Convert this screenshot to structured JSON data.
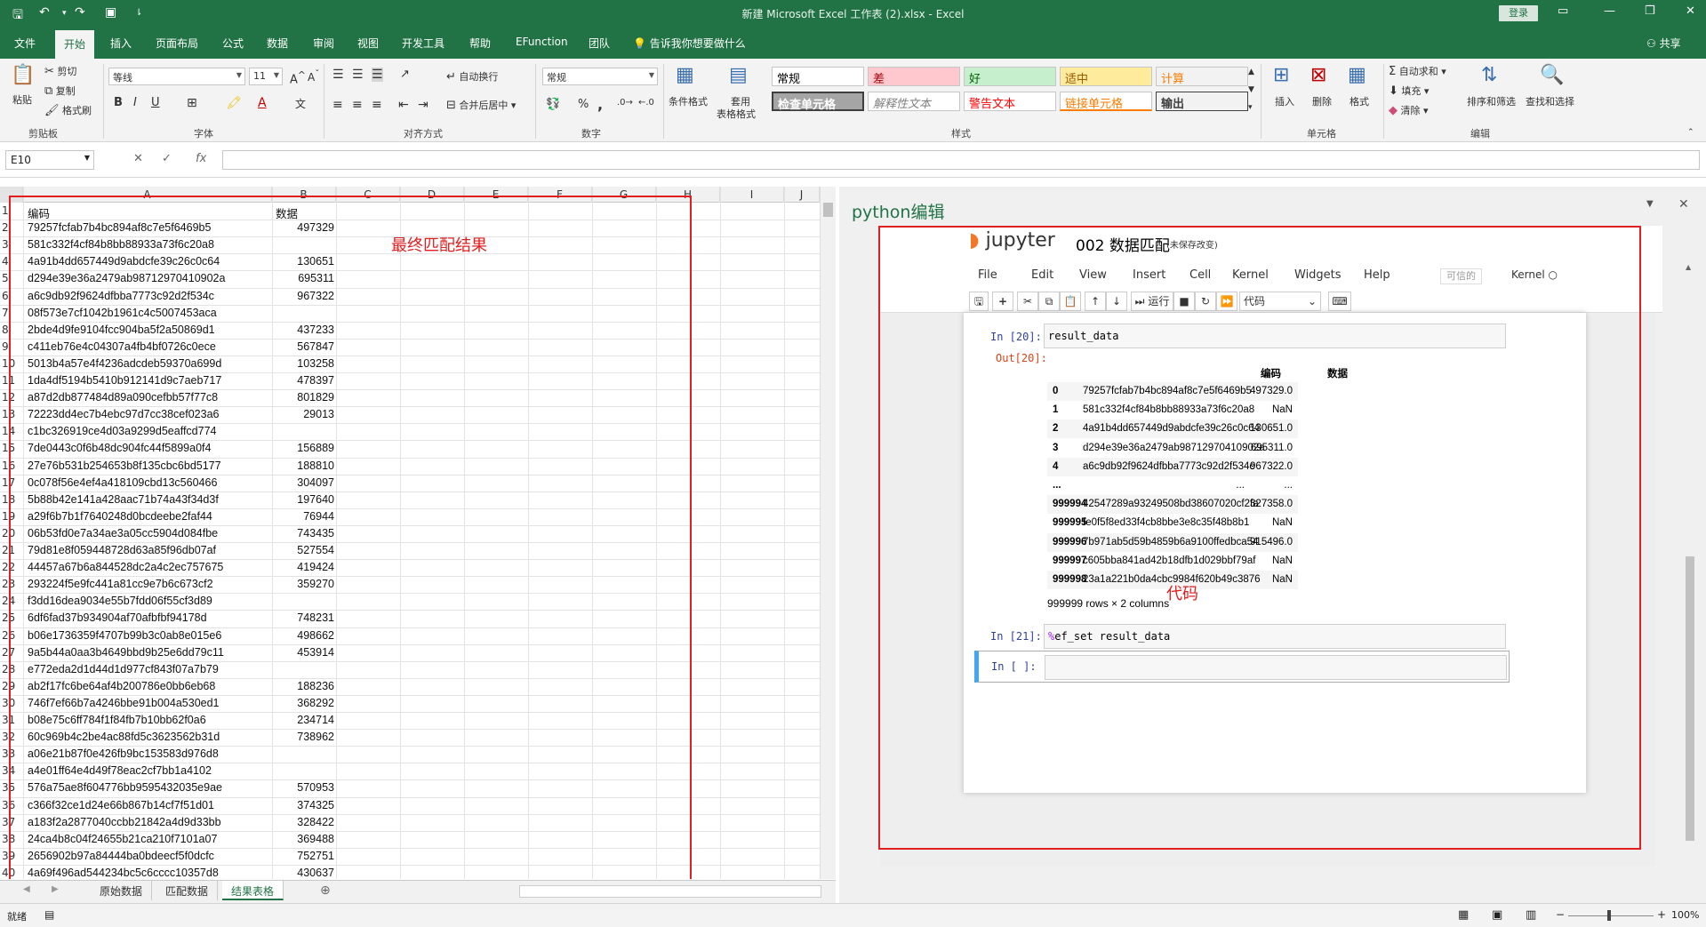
{
  "window": {
    "title": "新建 Microsoft Excel 工作表 (2).xlsx  -  Excel",
    "login": "登录"
  },
  "tabs": [
    "文件",
    "开始",
    "插入",
    "页面布局",
    "公式",
    "数据",
    "审阅",
    "视图",
    "开发工具",
    "帮助",
    "EFunction",
    "团队"
  ],
  "tellme": "告诉我你想要做什么",
  "share": "共享",
  "ribbon": {
    "clipboard": {
      "paste": "粘贴",
      "cut": "剪切",
      "copy": "复制",
      "format_painter": "格式刷",
      "label": "剪贴板"
    },
    "font": {
      "name": "等线",
      "size": "11",
      "label": "字体",
      "bold": "B",
      "italic": "I",
      "underline": "U"
    },
    "align": {
      "wrap": "自动换行",
      "merge": "合并后居中",
      "label": "对齐方式"
    },
    "number": {
      "format": "常规",
      "percent": "%",
      "comma": ",",
      "label": "数字"
    },
    "styles": {
      "conditional": "条件格式",
      "table_line1": "套用",
      "table_line2": "表格格式",
      "label": "样式",
      "cells": [
        {
          "text": "常规",
          "bg": "#ffffff",
          "fg": "#000000"
        },
        {
          "text": "差",
          "bg": "#ffc7ce",
          "fg": "#9c0006"
        },
        {
          "text": "好",
          "bg": "#c6efce",
          "fg": "#006100"
        },
        {
          "text": "适中",
          "bg": "#ffeb9c",
          "fg": "#9c5700"
        },
        {
          "text": "计算",
          "bg": "#f2f2f2",
          "fg": "#fa7d00"
        },
        {
          "text": "检查单元格",
          "bg": "#a5a5a5",
          "fg": "#ffffff"
        },
        {
          "text": "解释性文本",
          "bg": "#ffffff",
          "fg": "#7f7f7f"
        },
        {
          "text": "警告文本",
          "bg": "#ffffff",
          "fg": "#ff0000"
        },
        {
          "text": "链接单元格",
          "bg": "#ffffff",
          "fg": "#fa7d00"
        },
        {
          "text": "输出",
          "bg": "#f2f2f2",
          "fg": "#3f3f3f"
        }
      ]
    },
    "cells": {
      "insert": "插入",
      "delete": "删除",
      "format": "格式",
      "label": "单元格"
    },
    "editing": {
      "autosum": "自动求和",
      "fill": "填充",
      "clear": "清除",
      "sort": "排序和筛选",
      "find": "查找和选择",
      "label": "编辑"
    }
  },
  "formula_bar": {
    "name_box": "E10",
    "fx": "fx",
    "value": ""
  },
  "grid": {
    "columns": [
      "A",
      "B",
      "C",
      "D",
      "E",
      "F",
      "G",
      "H",
      "I",
      "J"
    ],
    "header_row": {
      "a": "编码",
      "b": "数据"
    },
    "rows": [
      {
        "n": "2",
        "a": "79257fcfab7b4bc894af8c7e5f6469b5",
        "b": "497329"
      },
      {
        "n": "3",
        "a": "581c332f4cf84b8bb88933a73f6c20a8",
        "b": ""
      },
      {
        "n": "4",
        "a": "4a91b4dd657449d9abdcfe39c26c0c64",
        "b": "130651"
      },
      {
        "n": "5",
        "a": "d294e39e36a2479ab98712970410902a",
        "b": "695311"
      },
      {
        "n": "6",
        "a": "a6c9db92f9624dfbba7773c92d2f534c",
        "b": "967322"
      },
      {
        "n": "7",
        "a": "08f573e7cf1042b1961c4c5007453aca",
        "b": ""
      },
      {
        "n": "8",
        "a": "2bde4d9fe9104fcc904ba5f2a50869d1",
        "b": "437233"
      },
      {
        "n": "9",
        "a": "c411eb76e4c04307a4fb4bf0726c0ece",
        "b": "567847"
      },
      {
        "n": "10",
        "a": "5013b4a57e4f4236adcdeb59370a699d",
        "b": "103258"
      },
      {
        "n": "11",
        "a": "1da4df5194b5410b912141d9c7aeb717",
        "b": "478397"
      },
      {
        "n": "12",
        "a": "a87d2db877484d89a090cefbb57f77c8",
        "b": "801829"
      },
      {
        "n": "13",
        "a": "72223dd4ec7b4ebc97d7cc38cef023a6",
        "b": "29013"
      },
      {
        "n": "14",
        "a": "c1bc326919ce4d03a9299d5eaffcd774",
        "b": ""
      },
      {
        "n": "15",
        "a": "7de0443c0f6b48dc904fc44f5899a0f4",
        "b": "156889"
      },
      {
        "n": "16",
        "a": "27e76b531b254653b8f135cbc6bd5177",
        "b": "188810"
      },
      {
        "n": "17",
        "a": "0c078f56e4ef4a418109cbd13c560466",
        "b": "304097"
      },
      {
        "n": "18",
        "a": "5b88b42e141a428aac71b74a43f34d3f",
        "b": "197640"
      },
      {
        "n": "19",
        "a": "a29f6b7b1f7640248d0bcdeebe2faf44",
        "b": "76944"
      },
      {
        "n": "20",
        "a": "06b53fd0e7a34ae3a05cc5904d084fbe",
        "b": "743435"
      },
      {
        "n": "21",
        "a": "79d81e8f059448728d63a85f96db07af",
        "b": "527554"
      },
      {
        "n": "22",
        "a": "44457a67b6a844528dc2a4c2ec757675",
        "b": "419424"
      },
      {
        "n": "23",
        "a": "293224f5e9fc441a81cc9e7b6c673cf2",
        "b": "359270"
      },
      {
        "n": "24",
        "a": "f3dd16dea9034e55b7fdd06f55cf3d89",
        "b": ""
      },
      {
        "n": "25",
        "a": "6df6fad37b934904af70afbfbf94178d",
        "b": "748231"
      },
      {
        "n": "26",
        "a": "b06e1736359f4707b99b3c0ab8e015e6",
        "b": "498662"
      },
      {
        "n": "27",
        "a": "9a5b44a0aa3b4649bbd9b25e6dd79c11",
        "b": "453914"
      },
      {
        "n": "28",
        "a": "e772eda2d1d44d1d977cf843f07a7b79",
        "b": ""
      },
      {
        "n": "29",
        "a": "ab2f17fc6be64af4b200786e0bb6eb68",
        "b": "188236"
      },
      {
        "n": "30",
        "a": "746f7ef66b7a4246bbe91b004a530ed1",
        "b": "368292"
      },
      {
        "n": "31",
        "a": "b08e75c6ff784f1f84fb7b10bb62f0a6",
        "b": "234714"
      },
      {
        "n": "32",
        "a": "60c969b4c2be4ac88fd5c3623562b31d",
        "b": "738962"
      },
      {
        "n": "33",
        "a": "a06e21b87f0e426fb9bc153583d976d8",
        "b": ""
      },
      {
        "n": "34",
        "a": "a4e01ff64e4d49f78eac2cf7bb1a4102",
        "b": ""
      },
      {
        "n": "35",
        "a": "576a75ae8f604776bb9595432035e9ae",
        "b": "570953"
      },
      {
        "n": "36",
        "a": "c366f32ce1d24e66b867b14cf7f51d01",
        "b": "374325"
      },
      {
        "n": "37",
        "a": "a183f2a2877040ccbb21842a4d9d33bb",
        "b": "328422"
      },
      {
        "n": "38",
        "a": "24ca4b8c04f24655b21ca210f7101a07",
        "b": "369488"
      },
      {
        "n": "39",
        "a": "2656902b97a84444ba0bdeecf5f0dcfc",
        "b": "752751"
      },
      {
        "n": "40",
        "a": "4a69f496ad544234bc5c6cccc10357d8",
        "b": "430637"
      }
    ],
    "annotation": "最终匹配结果"
  },
  "sheets": [
    "原始数据",
    "匹配数据",
    "结果表格"
  ],
  "status": {
    "ready": "就绪",
    "zoom": "100%"
  },
  "python": {
    "title": "python编辑",
    "notebook": {
      "logo": "jupyter",
      "name": "002 数据匹配",
      "unsaved": "(未保存改变)",
      "trusted": "可信的",
      "kernel": "Kernel",
      "menus": [
        "File",
        "Edit",
        "View",
        "Insert",
        "Cell",
        "Kernel",
        "Widgets",
        "Help"
      ],
      "run": "运行",
      "celltype": "代码"
    },
    "cell20": {
      "in": "In  [20]:",
      "code": "result_data",
      "out": "Out[20]:"
    },
    "df": {
      "cols": [
        "编码",
        "数据"
      ],
      "rows": [
        {
          "i": "0",
          "c": "79257fcfab7b4bc894af8c7e5f6469b5",
          "d": "497329.0"
        },
        {
          "i": "1",
          "c": "581c332f4cf84b8bb88933a73f6c20a8",
          "d": "NaN"
        },
        {
          "i": "2",
          "c": "4a91b4dd657449d9abdcfe39c26c0c64",
          "d": "130651.0"
        },
        {
          "i": "3",
          "c": "d294e39e36a2479ab98712970410902a",
          "d": "695311.0"
        },
        {
          "i": "4",
          "c": "a6c9db92f9624dfbba7773c92d2f534c",
          "d": "967322.0"
        },
        {
          "i": "...",
          "c": "...",
          "d": "..."
        },
        {
          "i": "999994",
          "c": "42547289a93249508bd38607020cf2fa",
          "d": "327358.0"
        },
        {
          "i": "999995",
          "c": "fe0f5f8ed33f4cb8bbe3e8c35f48b8b1",
          "d": "NaN"
        },
        {
          "i": "999996",
          "c": "7b971ab5d59b4859b6a9100ffedbca54",
          "d": "915496.0"
        },
        {
          "i": "999997",
          "c": "c605bba841ad42b18dfb1d029bbf79af",
          "d": "NaN"
        },
        {
          "i": "999998",
          "c": "23a1a221b0da4cbc9984f620b49c3876",
          "d": "NaN"
        }
      ],
      "shape": "999999 rows × 2 columns"
    },
    "cell21": {
      "in": "In  [21]:",
      "code": "%ef_set result_data"
    },
    "cell_empty": {
      "in": "In  [  ]:"
    },
    "annotation": "代码"
  }
}
